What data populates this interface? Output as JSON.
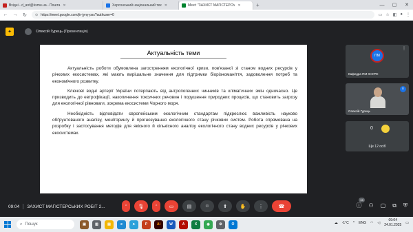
{
  "browser": {
    "tabs": [
      {
        "title": "Вхідні - d_ant@ksmu.ua - Пошта",
        "color": "#c5221f",
        "active": false
      },
      {
        "title": "Херсонський національний тех",
        "color": "#1a73e8",
        "active": false
      },
      {
        "title": "Meet: \"ЗАХИСТ МАГІСТЕРСЬ",
        "color": "#00832d",
        "active": true
      }
    ],
    "new_tab": "+",
    "url": "https://meet.google.com/jir-jyny-psx?authuser=0"
  },
  "meet": {
    "presenter_label": "Олексій Гурець (Презентація)",
    "slide": {
      "title": "Актуальність теми",
      "paragraphs": [
        "Актуальність роботи обумовлена загостренням екологічної кризи, пов'язаної зі станом водних ресурсів у річкових екосистемах, які мають вирішальне значення для підтримки біорізноманіття, задоволення потреб та економічного розвитку.",
        "Ключові водні артерії України потерпають від антропогенних чинників та кліматичних змін одночасно. Це призводить до евтрофікації, накопичення токсичних речовин і порушення природних процесів, що становить загрозу для екологічної рівноваги, зокрема екосистеми Чорного моря.",
        "Необхідність відповідати європейським екологічним стандартам підкреслює важливість науково обґрунтованого аналізу, моніторингу й прогнозування екологічного стану річкових систем. Робота спрямована на розробку і застосування методів для якісного й кількісного аналізу екологічного стану водних ресурсів у річкових екосистемах."
      ]
    },
    "participants": [
      {
        "name": "Кафедра ПМ ХНУРЕ",
        "logo_text": "ПМ"
      },
      {
        "name": "Олексій Гурець"
      }
    ],
    "others_count": "0",
    "others_label": "Ще 12 осіб",
    "controls": {
      "time": "09:04",
      "meeting_title": "ЗАХИСТ МАГІСТЕРСЬКИХ РОБІТ 2...",
      "people_count": "15"
    }
  },
  "taskbar": {
    "search_placeholder": "Пошук",
    "weather": "-1°C",
    "lang": "ENG",
    "time": "09:04",
    "date": "24.01.2025"
  }
}
